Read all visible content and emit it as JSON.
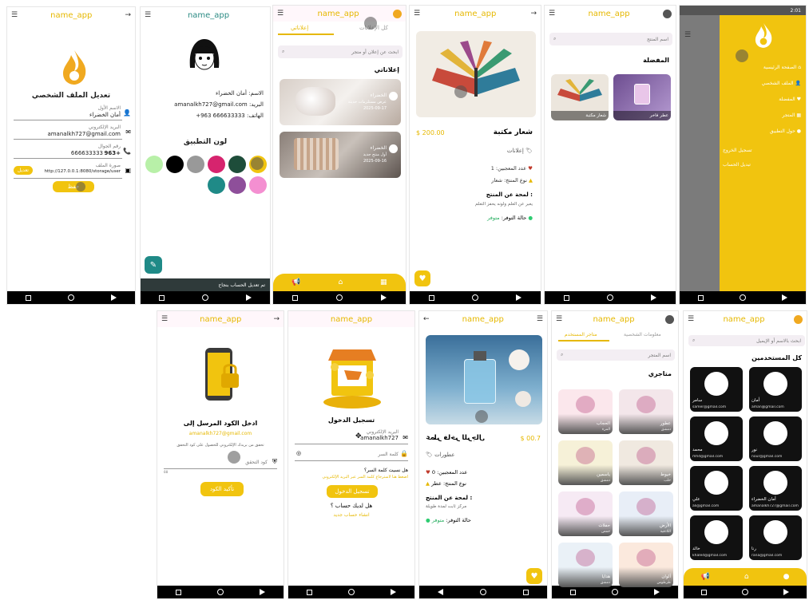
{
  "app_name": "name_app",
  "s1": {
    "title": "تعديل الملف الشخصي",
    "f1_label": "الاسم الأول",
    "f1_value": "أمان الخضراء",
    "f2_label": "البريد الإلكتروني",
    "f2_value": "amanalkh727@gmail.com",
    "f3_label": "رقم الجوال",
    "f3_value": "666633333",
    "f3_code": "963+",
    "f4_label": "صورة الملف",
    "f4_value": "http://127.0.0.1:8080/storage/user",
    "f4_button": "تعديل",
    "save": "حفظ"
  },
  "s2": {
    "name_label": "الاسم:",
    "name_value": "أمان الخضراء",
    "email_label": "البريد:",
    "email_value": "amanalkh727@gmail.com",
    "phone_label": "الهاتف:",
    "phone_value": "666633333 963+",
    "colors_title": "لون التطبيق",
    "footer": "تم تعديل الحساب بنجاح",
    "palette": [
      "#f1c40f",
      "#1e4d3a",
      "#d6246e",
      "#999999",
      "#000000",
      "#b8f0a8",
      "#f48fd1",
      "#8e4f9a",
      "#1f8a87"
    ]
  },
  "s3": {
    "tab_all": "كل الإعلانات",
    "tab_mine": "إعلاناتي",
    "search": "ابحث عن إعلان أو متجر",
    "section": "إعلاناتي",
    "ad1_title": "الخضراء",
    "ad1_sub": "عرض مستلزمات حديثة",
    "ad1_date": "2025-09-17",
    "ad2_title": "الخضراء",
    "ad2_sub": "أول منتج جديد",
    "ad2_date": "2025-09-16"
  },
  "s4": {
    "price": "$ 200.00",
    "name": "شعار مكتبة",
    "category": "إعلانات",
    "likes": "عدد المعجبين: 1",
    "type": "نوع المنتج: شعار",
    "about_title": "لمحة عن المنتج :",
    "about_text": "يعبر عن العلم ولونه يحفز التعلم",
    "status_label": "حالة التوفر:",
    "status_value": "متوفر"
  },
  "s5": {
    "search": "اسم المنتج",
    "section": "المفضلة",
    "fav1": "شعار مكتبة",
    "fav2": "عطر فاخر"
  },
  "s6": {
    "status_time": "2:01",
    "items": [
      "الصفحة الرئيسية",
      "الملف الشخصي",
      "المفضلة",
      "المتجر",
      "حول التطبيق",
      "تسجيل الخروج",
      "تبديل الحساب"
    ]
  },
  "s7": {
    "title": "ادخل الكود المرسل إلى",
    "email": "amanalkh727@gmail.com",
    "hint": "تحقق من بريدك الإلكتروني للحصول على كود التحقق",
    "code_label": "كود التحقق",
    "code_value": "٥٥",
    "confirm": "تأكيد الكود"
  },
  "s8": {
    "title": "تسجيل الدخول",
    "email_label": "البريد الإلكتروني",
    "email_value": "amanalkh727",
    "password_label": "كلمة السر",
    "forgot": "هل نسيت كلمة السر؟",
    "forgot_hint": "اضغط هنا لاسترجاع كلمة السر عبر البريد الإلكتروني",
    "login": "تسجيل الدخول",
    "no_account": "هل لديك حساب ؟",
    "create": "انشاء حساب جديد"
  },
  "s9": {
    "app": "name_app",
    "price": "$ 00.7",
    "name": "عطر فاخر للرجال",
    "category": "عطورات",
    "likes": "عدد المعجبين: 0",
    "type": "نوع المنتج: عطر",
    "about_title": "لمحة عن المنتج :",
    "about_text": "مركز ثابت لمدة طويلة",
    "status_label": "حالة التوفر:",
    "status_value": "متوفر"
  },
  "s10": {
    "tab_info": "معلومات الشخصية",
    "tab_stores": "متاجر المستخدم",
    "search": "اسم المتجر",
    "section": "متاجري",
    "stores": [
      {
        "name": "عطور",
        "loc": "دمشق"
      },
      {
        "name": "الحجاب",
        "loc": "المزة"
      },
      {
        "name": "خيوط",
        "loc": "حلب"
      },
      {
        "name": "ياسمين",
        "loc": "دمشق"
      },
      {
        "name": "الأرض",
        "loc": "اللاذقية"
      },
      {
        "name": "حفلات",
        "loc": "حمص"
      },
      {
        "name": "ألوان",
        "loc": "طرطوس"
      },
      {
        "name": "هدايا",
        "loc": "دمشق"
      }
    ]
  },
  "s11": {
    "search": "ابحث بالاسم أو الإيميل",
    "section": "كل المستخدمين",
    "users": [
      {
        "name": "أمان",
        "email": "aman@gmail.com"
      },
      {
        "name": "سامر",
        "email": "samer@gmail.com"
      },
      {
        "name": "نور",
        "email": "nour@gmail.com"
      },
      {
        "name": "محمد",
        "email": "mhd@gmail.com"
      },
      {
        "name": "أمان الخضراء",
        "email": "amanalkh727@gmail.com"
      },
      {
        "name": "علي",
        "email": "ali@gmail.com"
      },
      {
        "name": "رنا",
        "email": "rana@gmail.com"
      },
      {
        "name": "خالد",
        "email": "khaled@gmail.com"
      }
    ]
  }
}
